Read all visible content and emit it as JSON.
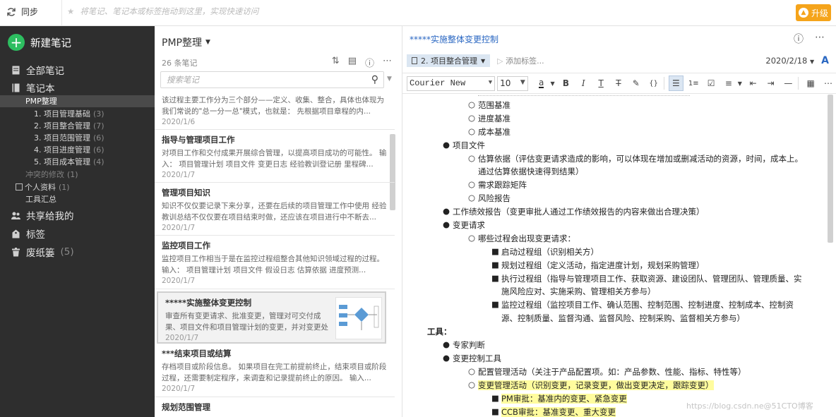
{
  "topbar": {
    "sync_label": "同步",
    "search_hint": "将笔记、笔记本或标签拖动到这里，实现快速访问",
    "upgrade_label": "升级"
  },
  "sidebar": {
    "new_note": "新建笔记",
    "all_notes": "全部笔记",
    "notebooks": "笔记本",
    "pmp": "PMP整理",
    "sub": [
      {
        "label": "1. 项目管理基础",
        "count": "(3)"
      },
      {
        "label": "2. 项目整合管理",
        "count": "(7)"
      },
      {
        "label": "3. 项目范围管理",
        "count": "(6)"
      },
      {
        "label": "4. 项目进度管理",
        "count": "(6)"
      },
      {
        "label": "5. 项目成本管理",
        "count": "(4)"
      }
    ],
    "conflict": "冲突的修改",
    "conflict_count": "(1)",
    "personal": "个人资料",
    "personal_count": "(1)",
    "tools": "工具汇总",
    "shared": "共享给我的",
    "tags": "标签",
    "trash": "废纸篓",
    "trash_count": "(5)"
  },
  "notelist": {
    "title": "PMP整理",
    "count": "26 条笔记",
    "search_placeholder": "搜索笔记",
    "notes": [
      {
        "title": "",
        "snippet": "该过程主要工作分为三个部分——定义、收集、整合，具体也体现为我们常说的\"总一分一总\"模式，也就是： 先根据项目章程的内...",
        "date": "2020/1/6"
      },
      {
        "title": "指导与管理项目工作",
        "snippet": "对项目工作和交付成果开展综合管理，以提高项目成功的可能性。 输入： 项目管理计划 项目文件 变更日志 经验教训登记册 里程碑...",
        "date": "2020/1/7"
      },
      {
        "title": "管理项目知识",
        "snippet": "知识不仅仅要记录下来分享，还要在后续的项目管理工作中使用 经验教训总结不仅仅要在项目结束时做，还应该在项目进行中不断去...",
        "date": "2020/1/7"
      },
      {
        "title": "监控项目工作",
        "snippet": "监控项目工作相当于是在监控过程组整合其他知识领域过程的过程。 输入： 项目管理计划 项目文件 假设日志 估算依据 进度预测...",
        "date": "2020/1/7"
      },
      {
        "title": "*****实施整体变更控制",
        "snippet": "审查所有变更请求、批准变更，管理对可交付成果、项目文件和项目管理计划的变更，并对变更处理结...",
        "date": "2020/1/7"
      },
      {
        "title": "***结束项目或结算",
        "snippet": "存档项目或阶段信息。 如果项目在完工前提前终止，结束项目或阶段过程，还需要制定程序，来调查和记录提前终止的原因。 输入...",
        "date": "2020/1/7"
      },
      {
        "title": "规划范围管理",
        "snippet": "",
        "date": ""
      }
    ]
  },
  "editor": {
    "title": "*****实施整体变更控制",
    "notebook": "2. 项目整合管理",
    "add_tag": "添加标签...",
    "date": "2020/2/18",
    "font": "Courier New",
    "size": "10",
    "lines": [
      "范围基准",
      "进度基准",
      "成本基准",
      "项目文件",
      "估算依据（评估变更请求造成的影响，可以体现在增加或删减活动的资源，时间，成本上。",
      "通过估算依据快速得到结果）",
      "需求跟踪矩阵",
      "风险报告",
      "工作绩效报告（变更审批人通过工作绩效报告的内容来做出合理决策）",
      "变更请求",
      "哪些过程会出现变更请求：",
      "启动过程组（识别相关方）",
      "规划过程组（定义活动，指定进度计划，规划采购管理）",
      "执行过程组（指导与管理项目工作、获取资源、建设团队、管理团队、管理质量、实",
      "施风险应对、实施采购、管理相关方参与）",
      "监控过程组（监控项目工作、确认范围、控制范围、控制进度、控制成本、控制资",
      "源、控制质量、监督沟通、监督风险、控制采购、监督相关方参与）",
      "工具：",
      "专家判断",
      "变更控制工具",
      "配置管理活动（关注于产品配置项。如：产品参数、性能、指标、特性等）",
      "变更管理活动（识别变更，记录变更，做出变更决定，跟踪变更）",
      "PM审批：基准内的变更、紧急变更",
      "CCB审批：基准变更、重大变更"
    ]
  },
  "watermark": "https://blog.csdn.ne@51CTO博客"
}
